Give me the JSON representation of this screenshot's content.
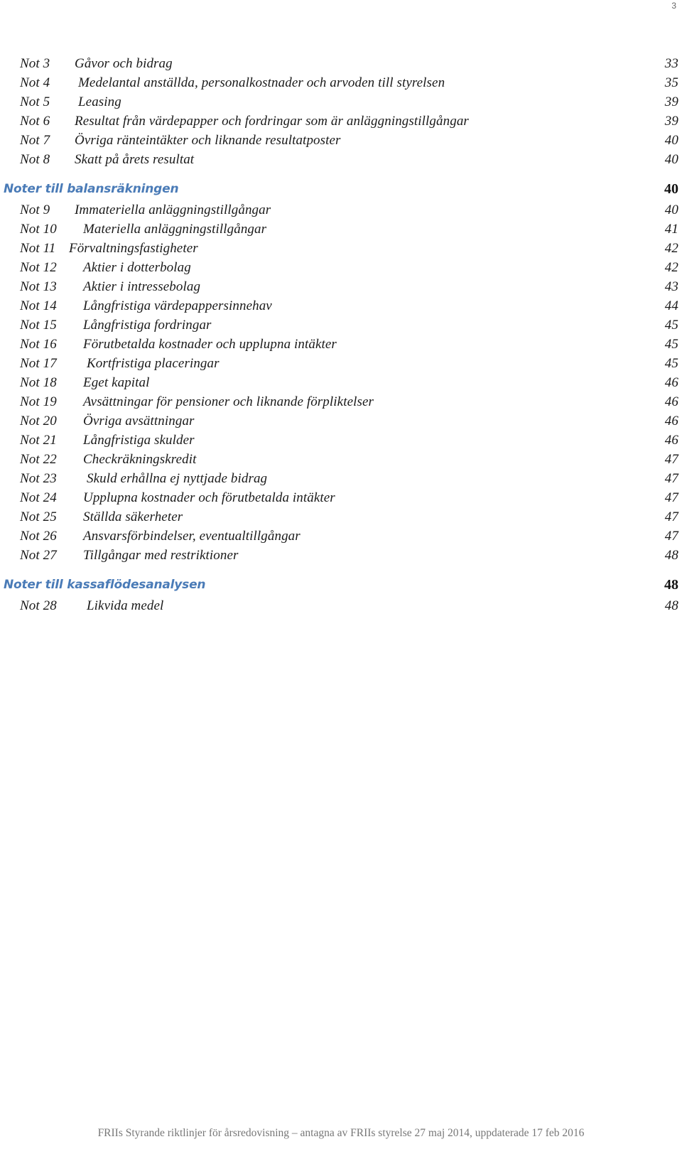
{
  "page_number": "3",
  "sections": [
    {
      "heading": null,
      "entries": [
        {
          "num": "Not 3",
          "title": "Gåvor och bidrag",
          "page": "33",
          "indent": 105
        },
        {
          "num": "Not 4",
          "title": "Medelantal anställda, personalkostnader och arvoden till styrelsen",
          "page": "35",
          "indent": 110
        },
        {
          "num": "Not 5",
          "title": "Leasing",
          "page": "39",
          "indent": 110
        },
        {
          "num": "Not 6",
          "title": "Resultat från värdepapper och fordringar som är anläggningstillgångar",
          "page": "39",
          "indent": 105
        },
        {
          "num": "Not 7",
          "title": "Övriga ränteintäkter och liknande resultatposter",
          "page": "40",
          "indent": 105
        },
        {
          "num": "Not 8",
          "title": "Skatt på årets resultat",
          "page": "40",
          "indent": 105
        }
      ]
    },
    {
      "heading": {
        "title": "Noter till balansräkningen",
        "page": "40"
      },
      "entries": [
        {
          "num": "Not 9",
          "title": "Immateriella anläggningstillgångar",
          "page": "40",
          "indent": 105
        },
        {
          "num": "Not 10",
          "title": "Materiella anläggningstillgångar",
          "page": "41",
          "indent": 117
        },
        {
          "num": "Not 11",
          "title": "Förvaltningsfastigheter",
          "page": "42",
          "indent": 97
        },
        {
          "num": "Not 12",
          "title": "Aktier i dotterbolag",
          "page": "42",
          "indent": 117
        },
        {
          "num": "Not 13",
          "title": "Aktier i intressebolag",
          "page": "43",
          "indent": 117
        },
        {
          "num": "Not 14",
          "title": "Långfristiga värdepappersinnehav",
          "page": "44",
          "indent": 117
        },
        {
          "num": "Not 15",
          "title": "Långfristiga fordringar",
          "page": "45",
          "indent": 117
        },
        {
          "num": "Not 16",
          "title": "Förutbetalda kostnader och upplupna intäkter",
          "page": "45",
          "indent": 117
        },
        {
          "num": "Not 17",
          "title": "Kortfristiga placeringar",
          "page": "45",
          "indent": 122
        },
        {
          "num": "Not 18",
          "title": "Eget kapital",
          "page": "46",
          "indent": 117
        },
        {
          "num": "Not 19",
          "title": "Avsättningar för pensioner och liknande förpliktelser",
          "page": "46",
          "indent": 117
        },
        {
          "num": "Not 20",
          "title": "Övriga avsättningar",
          "page": "46",
          "indent": 117
        },
        {
          "num": "Not 21",
          "title": "Långfristiga skulder",
          "page": "46",
          "indent": 117
        },
        {
          "num": "Not 22",
          "title": "Checkräkningskredit",
          "page": "47",
          "indent": 117
        },
        {
          "num": "Not 23",
          "title": "Skuld erhållna ej nyttjade bidrag",
          "page": "47",
          "indent": 122
        },
        {
          "num": "Not 24",
          "title": "Upplupna kostnader och förutbetalda intäkter",
          "page": "47",
          "indent": 117
        },
        {
          "num": "Not 25",
          "title": "Ställda säkerheter",
          "page": "47",
          "indent": 117
        },
        {
          "num": "Not 26",
          "title": "Ansvarsförbindelser, eventualtillgångar",
          "page": "47",
          "indent": 117
        },
        {
          "num": "Not 27",
          "title": "Tillgångar med restriktioner",
          "page": "48",
          "indent": 117
        }
      ]
    },
    {
      "heading": {
        "title": "Noter till kassaflödesanalysen",
        "page": "48"
      },
      "entries": [
        {
          "num": "Not 28",
          "title": "Likvida medel",
          "page": "48",
          "indent": 122
        }
      ]
    }
  ],
  "footer": "FRIIs Styrande riktlinjer för årsredovisning – antagna av FRIIs styrelse 27 maj 2014, uppdaterade 17 feb 2016",
  "colors": {
    "heading": "#4a7bb7",
    "text": "#1a1a1a",
    "footer": "#777777"
  }
}
